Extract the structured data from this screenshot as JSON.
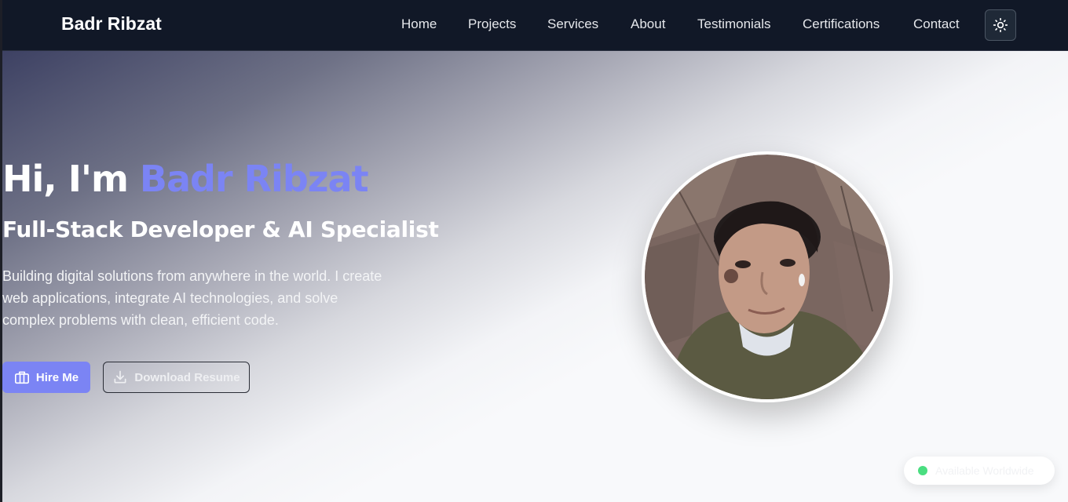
{
  "navbar": {
    "brand": "Badr Ribzat",
    "links": [
      "Home",
      "Projects",
      "Services",
      "About",
      "Testimonials",
      "Certifications",
      "Contact"
    ],
    "theme_toggle_icon": "sun-icon"
  },
  "hero": {
    "greeting": "Hi, I'm",
    "name": "Badr Ribzat",
    "subtitle": "Full-Stack Developer & AI Specialist",
    "description": "Building digital solutions from anywhere in the world. I create web applications, integrate AI technologies, and solve complex problems with clean, efficient code.",
    "primary_button": {
      "label": "Hire Me",
      "icon": "briefcase-icon"
    },
    "secondary_button": {
      "label": "Download Resume",
      "icon": "download-icon"
    },
    "avatar_alt": "profile-photo",
    "status": {
      "label": "Available Worldwide",
      "indicator_color": "#4ade80"
    }
  },
  "colors": {
    "navbar_bg": "#111827",
    "accent": "#7b84f4",
    "page_bg": "#f8f9fb"
  }
}
